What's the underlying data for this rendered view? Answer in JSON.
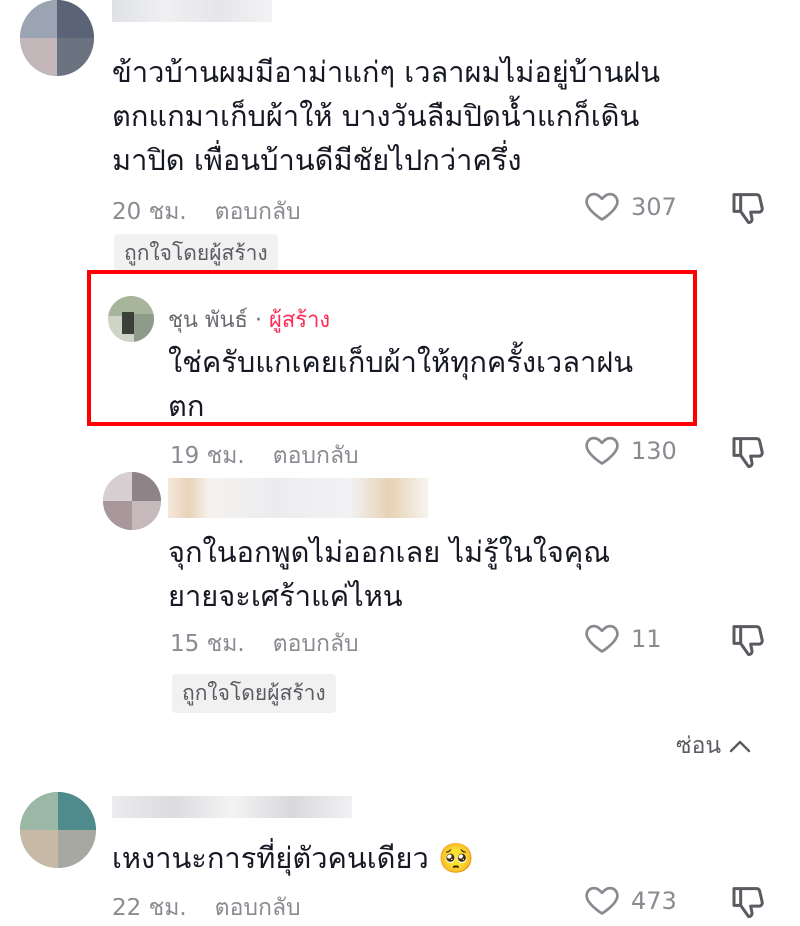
{
  "comments": [
    {
      "text_lines": [
        "ข้าวบ้านผมมีอาม่าแก่ๆ เวลาผมไม่อยู่บ้านฝน",
        "ตกแกมาเก็บผ้าให้ บางวันลืมปิดน้ำแกก็เดิน",
        "มาปิด เพื่อนบ้านดีมีชัยไปกว่าครึ่ง"
      ],
      "time": "20 ชม.",
      "reply_label": "ตอบกลับ",
      "likes": "307",
      "badge": "ถูกใจโดยผู้สร้าง"
    },
    {
      "author": "ชุน พันธ์",
      "separator": "·",
      "creator_label": "ผู้สร้าง",
      "text_lines": [
        "ใช่ครับแกเคยเก็บผ้าให้ทุกครั้งเวลาฝน",
        "ตก"
      ],
      "time": "19 ชม.",
      "reply_label": "ตอบกลับ",
      "likes": "130"
    },
    {
      "text_lines": [
        "จุกในอกพูดไม่ออกเลย ไม่รู้ในใจคุณ",
        "ยายจะเศร้าแค่ไหน"
      ],
      "time": "15 ชม.",
      "reply_label": "ตอบกลับ",
      "likes": "11",
      "badge": "ถูกใจโดยผู้สร้าง"
    },
    {
      "text": "เหงานะการที่ยุ่ตัวคนเดียว",
      "emoji": "🥺",
      "time": "22 ชม.",
      "reply_label": "ตอบกลับ",
      "likes": "473"
    }
  ],
  "hide_label": "ซ่อน",
  "icons": {
    "like": "heart-outline-icon",
    "dislike": "thumbs-down-icon",
    "hide": "chevron-up-icon"
  },
  "colors": {
    "highlight_border": "#ff0000",
    "creator_accent": "#fe2c55",
    "meta_text": "#8a8b91"
  }
}
